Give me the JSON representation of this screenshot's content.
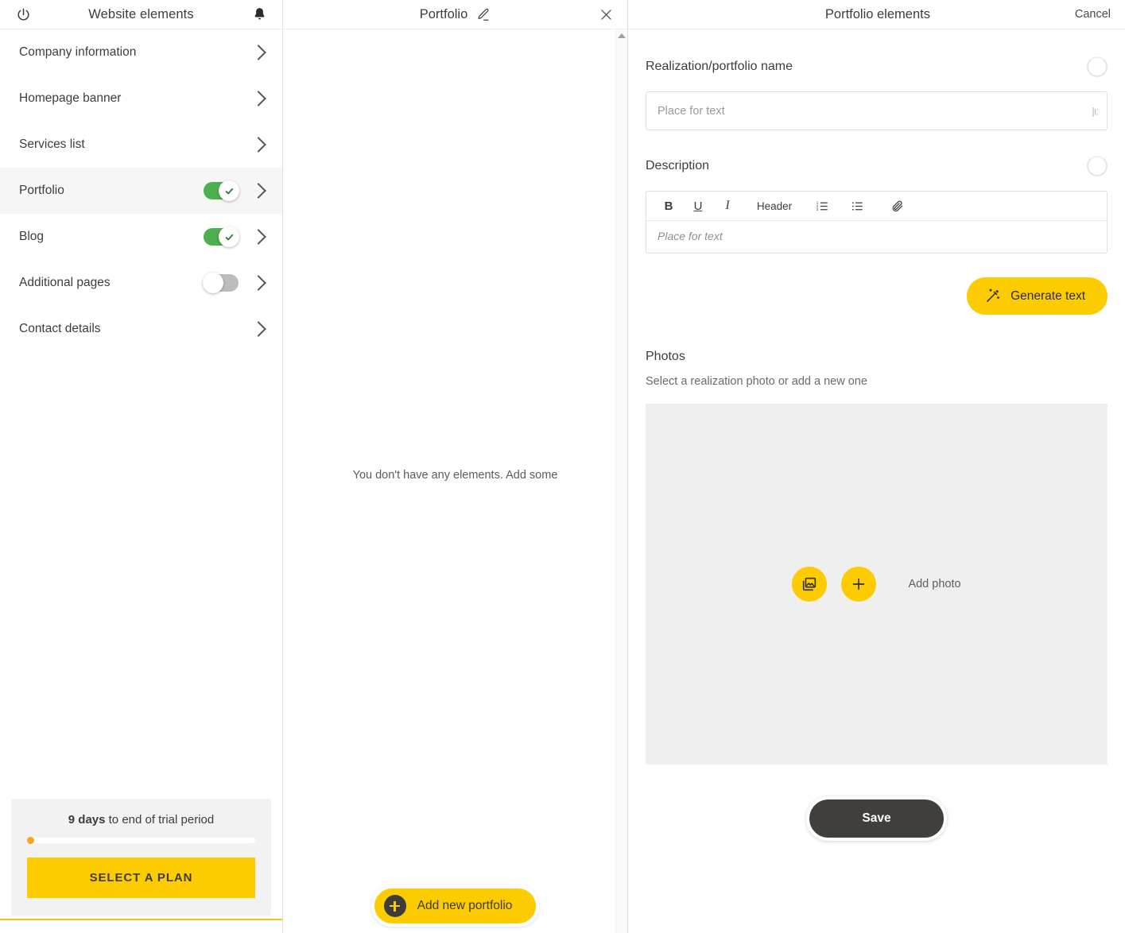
{
  "sidebar": {
    "header": {
      "title": "Website elements",
      "power_icon": "power-icon",
      "bell_icon": "bell-icon"
    },
    "items": [
      {
        "label": "Company information",
        "toggle": null
      },
      {
        "label": "Homepage banner",
        "toggle": null
      },
      {
        "label": "Services list",
        "toggle": null
      },
      {
        "label": "Portfolio",
        "toggle": "on",
        "active": true
      },
      {
        "label": "Blog",
        "toggle": "on"
      },
      {
        "label": "Additional pages",
        "toggle": "off"
      },
      {
        "label": "Contact details",
        "toggle": null
      }
    ],
    "trial": {
      "days": "9 days",
      "suffix": " to end of trial period",
      "progress_percent": 2,
      "cta_label": "SELECT A PLAN"
    }
  },
  "middle": {
    "title": "Portfolio",
    "edit_icon": "pencil-icon",
    "close_icon": "close-icon",
    "empty_message": "You don't have any elements. Add some",
    "add_button_label": "Add new portfolio"
  },
  "right": {
    "title": "Portfolio elements",
    "cancel_label": "Cancel",
    "name_field": {
      "label": "Realization/portfolio name",
      "placeholder": "Place for text",
      "value": ""
    },
    "description": {
      "label": "Description",
      "placeholder": "Place for text",
      "toolbar": [
        {
          "name": "bold-icon",
          "label": "B"
        },
        {
          "name": "underline-icon",
          "label": "U"
        },
        {
          "name": "italic-icon",
          "label": "I"
        },
        {
          "name": "header-button",
          "label": "Header"
        },
        {
          "name": "ordered-list-icon",
          "label": ""
        },
        {
          "name": "bullet-list-icon",
          "label": ""
        },
        {
          "name": "link-icon",
          "label": ""
        }
      ]
    },
    "generate_button_label": "Generate text",
    "photos": {
      "label": "Photos",
      "subtitle": "Select a realization photo or add a new one",
      "gallery_icon": "gallery-icon",
      "add_icon": "plus-icon",
      "add_label": "Add photo"
    },
    "save_label": "Save"
  },
  "colors": {
    "accent_yellow": "#fccb00",
    "toggle_green": "#4caf50",
    "dark_button": "#413f3c",
    "progress_dot": "#f5a623",
    "panel_gray": "#efefef"
  }
}
